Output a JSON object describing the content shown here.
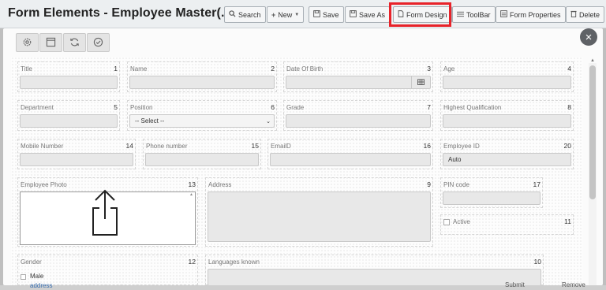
{
  "header": {
    "title": "Form Elements - Employee Master(...",
    "buttons": [
      {
        "label": "Search",
        "icon": "search-icon"
      },
      {
        "label": "New",
        "icon": "plus-icon"
      },
      {
        "label": "Save",
        "icon": "save-icon"
      },
      {
        "label": "Save As",
        "icon": "save-as-icon"
      },
      {
        "label": "Form Design",
        "icon": "document-icon"
      },
      {
        "label": "ToolBar",
        "icon": "list-icon"
      },
      {
        "label": "Form Properties",
        "icon": "form-icon"
      },
      {
        "label": "Delete",
        "icon": "trash-icon"
      }
    ]
  },
  "modal": {
    "toolbar_icons": [
      "gear-icon",
      "layout-icon",
      "refresh-icon",
      "check-circle-icon"
    ],
    "close_icon": "close-icon"
  },
  "fields": {
    "title": {
      "label": "Title",
      "order": "1"
    },
    "name": {
      "label": "Name",
      "order": "2"
    },
    "dob": {
      "label": "Date Of Birth",
      "order": "3"
    },
    "age": {
      "label": "Age",
      "order": "4"
    },
    "department": {
      "label": "Department",
      "order": "5"
    },
    "position": {
      "label": "Position",
      "order": "6",
      "value": "-- Select --"
    },
    "grade": {
      "label": "Grade",
      "order": "7"
    },
    "qualification": {
      "label": "Highest Qualification",
      "order": "8"
    },
    "mobile": {
      "label": "Mobile Number",
      "order": "14"
    },
    "phone": {
      "label": "Phone number",
      "order": "15"
    },
    "email": {
      "label": "EmailD",
      "order": "16"
    },
    "employee_id": {
      "label": "Employee ID",
      "order": "20",
      "value": "Auto"
    },
    "photo": {
      "label": "Employee Photo",
      "order": "13"
    },
    "address": {
      "label": "Address",
      "order": "9"
    },
    "pin": {
      "label": "PIN code",
      "order": "17"
    },
    "active": {
      "label": "Active",
      "order": "11"
    },
    "gender": {
      "label": "Gender",
      "order": "12",
      "option": "Male"
    },
    "languages": {
      "label": "Languages known",
      "order": "10"
    }
  },
  "behind": {
    "link": "address",
    "submit": "Submit",
    "remove": "Remove"
  }
}
